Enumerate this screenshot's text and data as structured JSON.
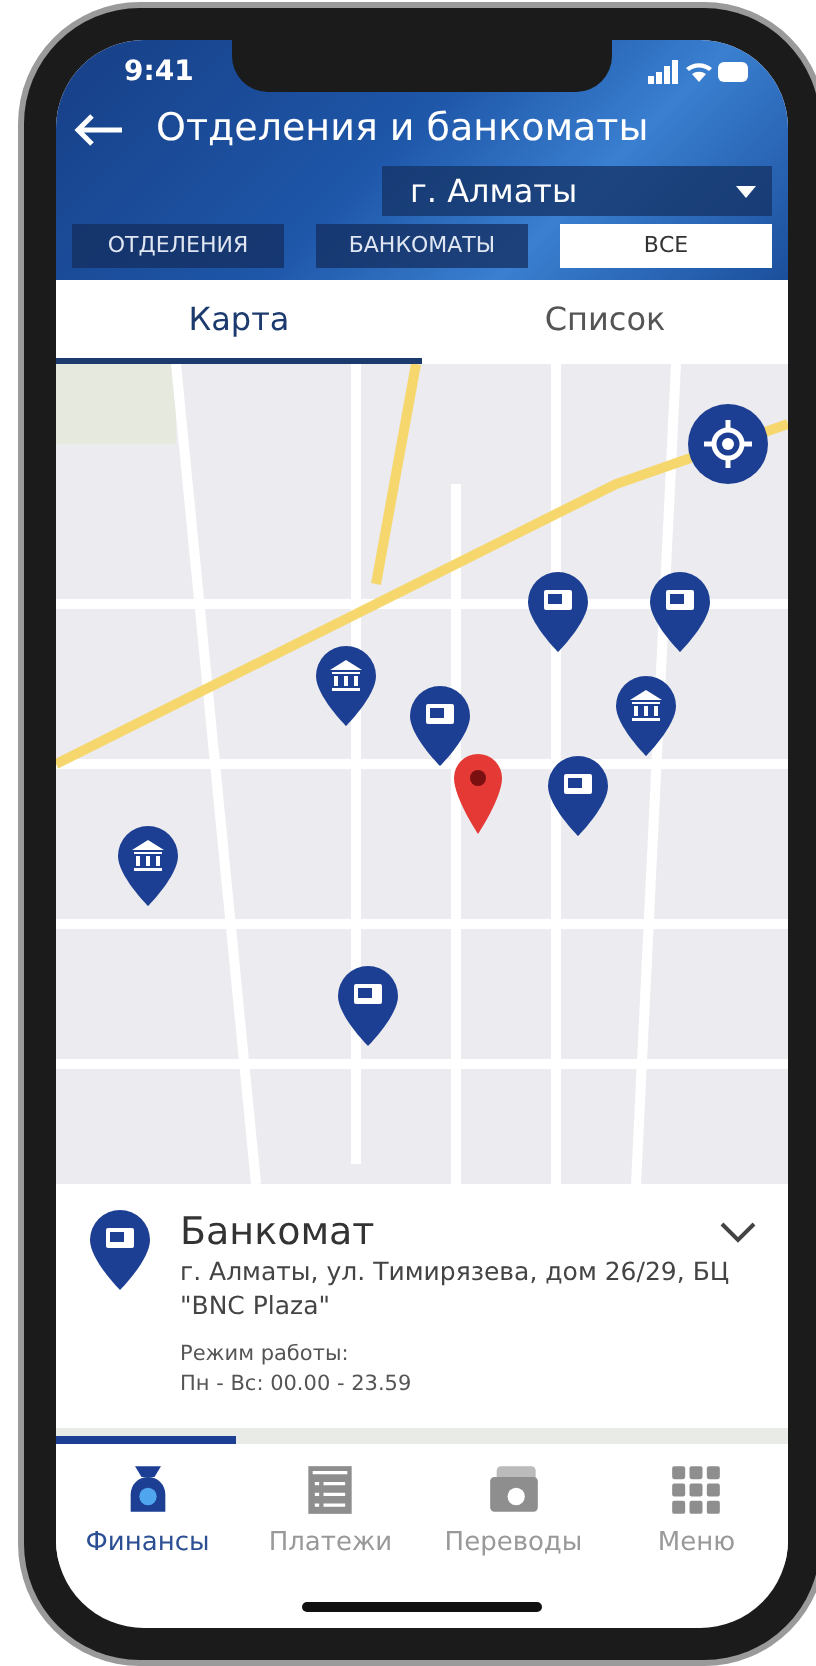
{
  "status_bar": {
    "time": "9:41"
  },
  "header": {
    "title": "Отделения и банкоматы",
    "city": "г. Алматы"
  },
  "filters": [
    {
      "label": "ОТДЕЛЕНИЯ",
      "selected": false
    },
    {
      "label": "БАНКОМАТЫ",
      "selected": false
    },
    {
      "label": "ВСЕ",
      "selected": true
    }
  ],
  "view_tabs": [
    {
      "label": "Карта",
      "selected": true
    },
    {
      "label": "Список",
      "selected": false
    }
  ],
  "map": {
    "kind": "picture",
    "pins": [
      {
        "kind": "atm"
      },
      {
        "kind": "atm"
      },
      {
        "kind": "bank"
      },
      {
        "kind": "bank"
      },
      {
        "kind": "atm"
      },
      {
        "kind": "atm"
      },
      {
        "kind": "bank"
      },
      {
        "kind": "atm"
      },
      {
        "kind": "current"
      }
    ]
  },
  "info_card": {
    "kind": "atm",
    "title": "Банкомат",
    "address": "г. Алматы, ул. Тимирязева, дом 26/29, БЦ \"BNC Plaza\"",
    "hours_label": "Режим работы:",
    "hours": "Пн - Вс: 00.00 - 23.59"
  },
  "bottom_nav": [
    {
      "label": "Финансы",
      "kind": "finance",
      "selected": true
    },
    {
      "label": "Платежи",
      "kind": "payments",
      "selected": false
    },
    {
      "label": "Переводы",
      "kind": "transfers",
      "selected": false
    },
    {
      "label": "Меню",
      "kind": "menu",
      "selected": false
    }
  ]
}
